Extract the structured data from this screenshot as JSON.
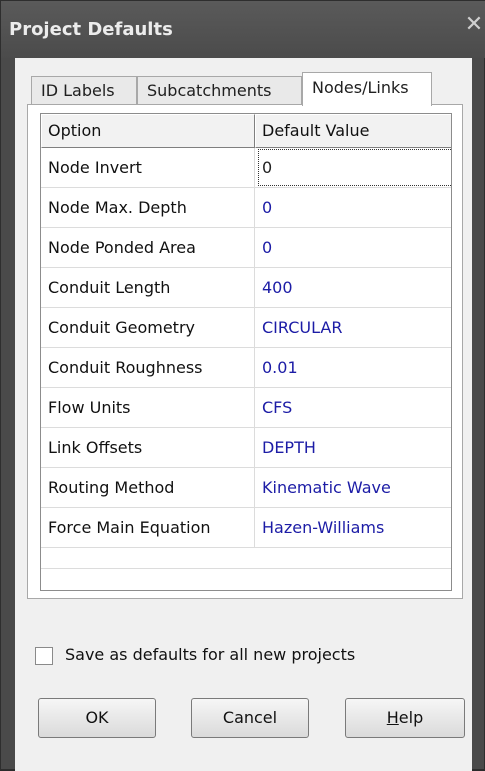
{
  "window": {
    "title": "Project Defaults",
    "close_glyph": "✕"
  },
  "tabs": [
    {
      "label": "ID Labels",
      "active": false
    },
    {
      "label": "Subcatchments",
      "active": false
    },
    {
      "label": "Nodes/Links",
      "active": true
    }
  ],
  "grid": {
    "headers": [
      "Option",
      "Default Value"
    ],
    "rows": [
      {
        "option": "Node Invert",
        "value": "0"
      },
      {
        "option": "Node Max. Depth",
        "value": "0"
      },
      {
        "option": "Node Ponded Area",
        "value": "0"
      },
      {
        "option": "Conduit Length",
        "value": "400"
      },
      {
        "option": "Conduit Geometry",
        "value": "CIRCULAR"
      },
      {
        "option": "Conduit Roughness",
        "value": "0.01"
      },
      {
        "option": "Flow Units",
        "value": "CFS"
      },
      {
        "option": "Link Offsets",
        "value": "DEPTH"
      },
      {
        "option": "Routing Method",
        "value": "Kinematic Wave"
      },
      {
        "option": "Force Main Equation",
        "value": "Hazen-Williams"
      }
    ]
  },
  "save_defaults": {
    "label": "Save as defaults for all new projects",
    "checked": false
  },
  "buttons": {
    "ok": "OK",
    "cancel": "Cancel",
    "help_first": "H",
    "help_rest": "elp"
  },
  "colors": {
    "value_text": "#1c1ca6",
    "titlebar": "#4b4b4b"
  }
}
